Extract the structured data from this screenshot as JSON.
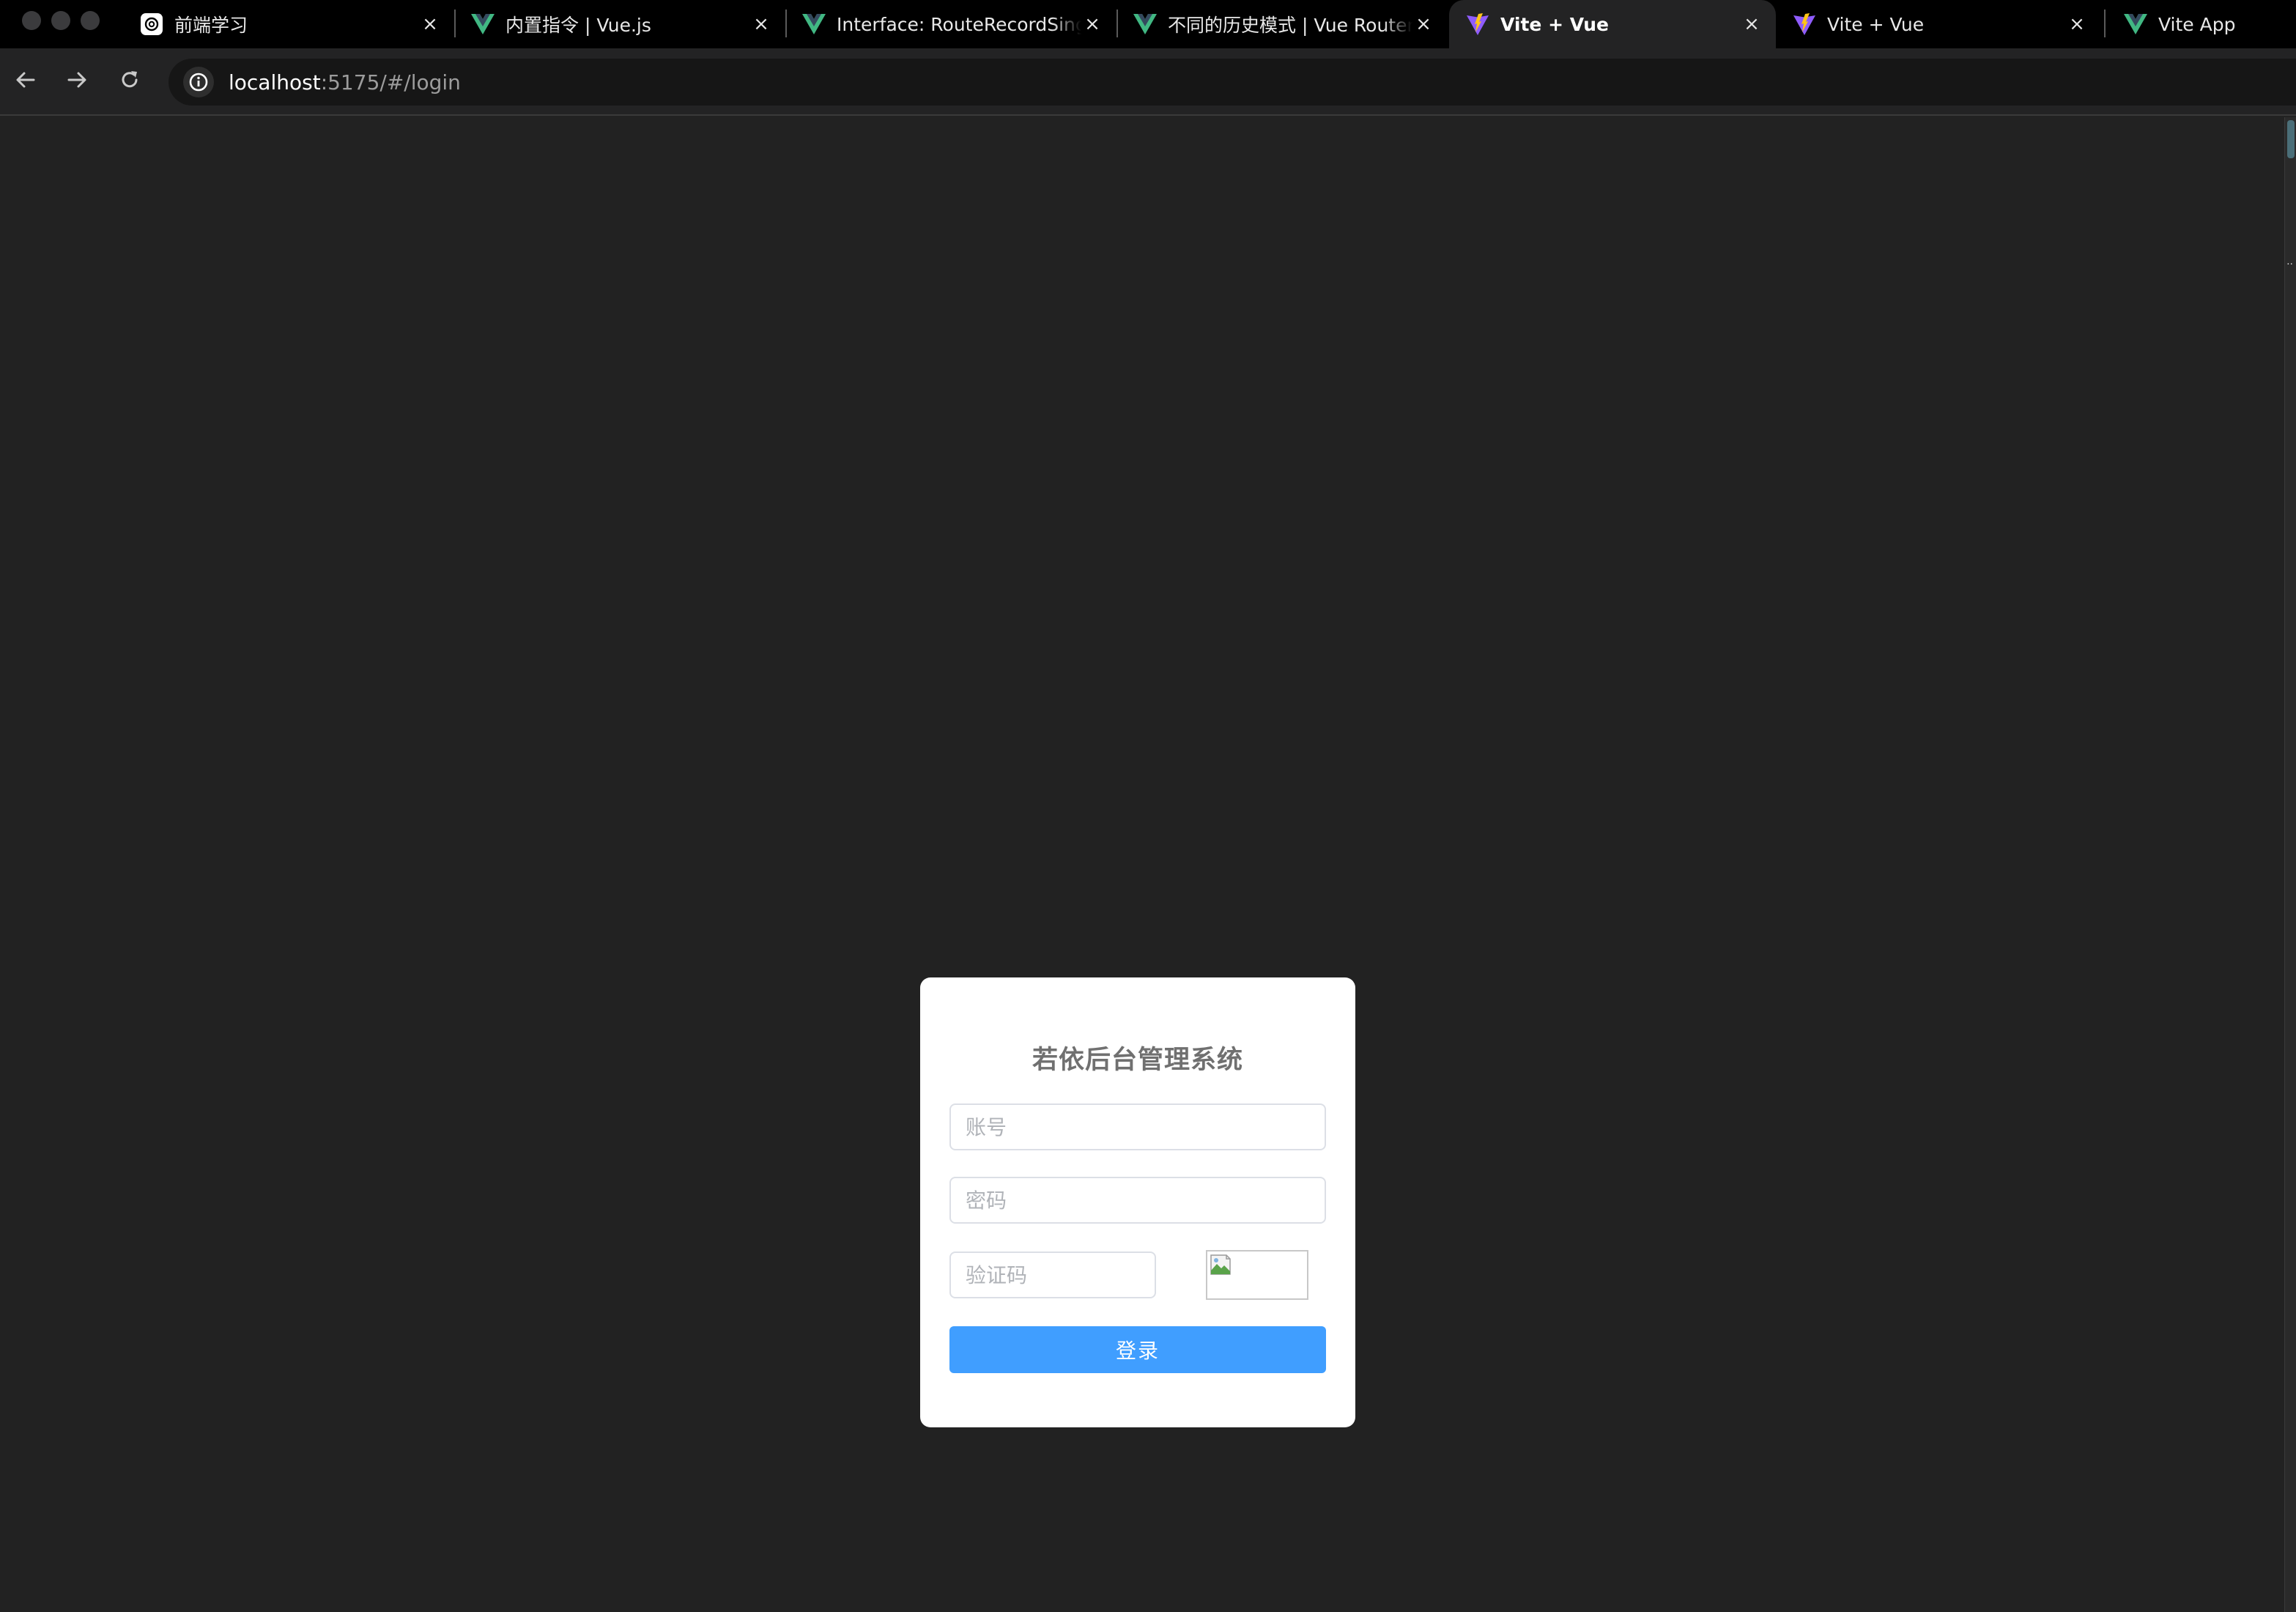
{
  "browser": {
    "tabs": [
      {
        "title": "前端学习",
        "favicon": "openai-icon"
      },
      {
        "title": "内置指令 | Vue.js",
        "favicon": "vue-icon"
      },
      {
        "title": "Interface: RouteRecordSingleView",
        "favicon": "vue-icon"
      },
      {
        "title": "不同的历史模式 | Vue Router",
        "favicon": "vue-icon"
      },
      {
        "title": "Vite + Vue",
        "favicon": "vite-icon",
        "active": true
      },
      {
        "title": "Vite + Vue",
        "favicon": "vite-icon"
      },
      {
        "title": "Vite App",
        "favicon": "vue-icon"
      }
    ],
    "close_glyph": "×",
    "url": {
      "host": "localhost",
      "rest": ":5175/#/login"
    }
  },
  "login": {
    "title": "若依后台管理系统",
    "username_placeholder": "账号",
    "password_placeholder": "密码",
    "captcha_placeholder": "验证码",
    "submit_label": "登录"
  },
  "colors": {
    "page_background": "#222222",
    "primary_button": "#409eff",
    "vue_green": "#41b883",
    "vite_purple": "#8f5cff",
    "vite_yellow": "#ffc517"
  }
}
